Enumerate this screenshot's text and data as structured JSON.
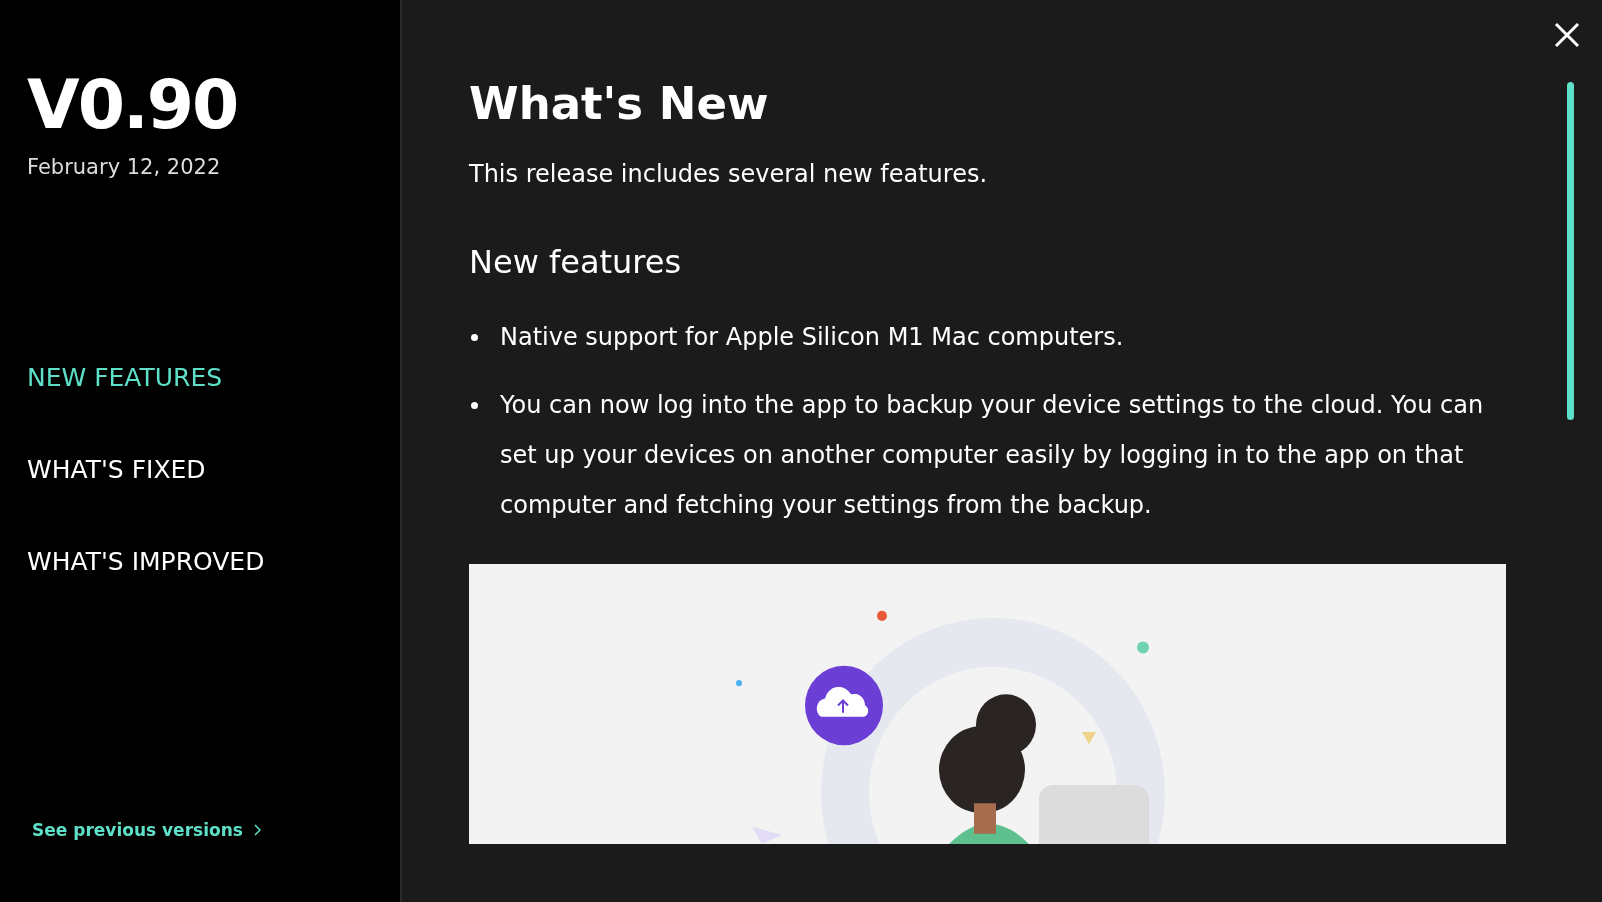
{
  "sidebar": {
    "version": "V0.90",
    "date": "February 12, 2022",
    "nav": [
      {
        "label": "NEW FEATURES",
        "selected": true
      },
      {
        "label": "WHAT'S FIXED",
        "selected": false
      },
      {
        "label": "WHAT'S IMPROVED",
        "selected": false
      }
    ],
    "footer_link": "See previous versions"
  },
  "content": {
    "title": "What's New",
    "intro": "This release includes several new features.",
    "section_heading": "New features",
    "bullets": [
      "Native support for Apple Silicon M1 Mac computers.",
      "You can now log into the app to backup your device settings to the cloud. You can set up your devices on another computer easily by logging in to the app on that computer and fetching your settings from the backup."
    ]
  }
}
